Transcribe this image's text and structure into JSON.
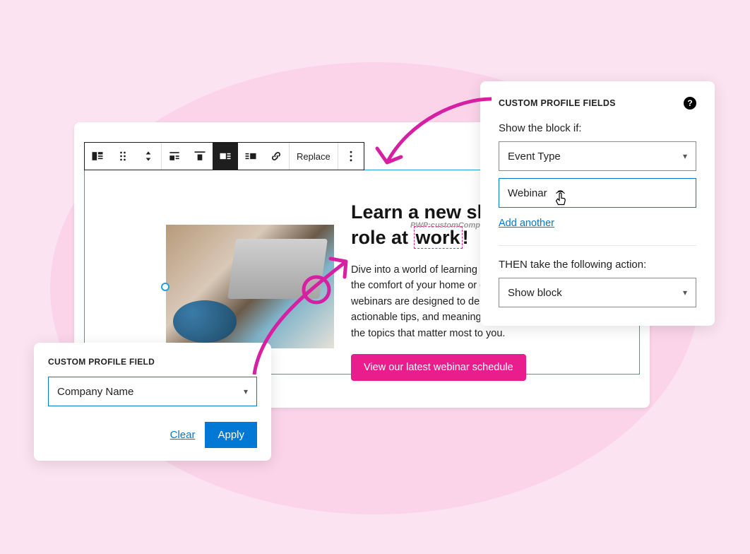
{
  "toolbar": {
    "replace_label": "Replace"
  },
  "block": {
    "heading_prefix": "Learn a new skill for your new role at ",
    "heading_highlight": "work",
    "heading_suffix": "!",
    "merge_tag": "PWP:customCompanyname",
    "body": "Dive into a world of learning and inspiration from the comfort of your home or office. EventSphere's webinars are designed to deliver expert insights, actionable tips, and meaningful discussions on the topics that matter most to you.",
    "cta_label": "View our latest webinar schedule"
  },
  "popup_left": {
    "title": "CUSTOM PROFILE FIELD",
    "selected": "Company Name",
    "clear_label": "Clear",
    "apply_label": "Apply"
  },
  "popup_right": {
    "title": "CUSTOM PROFILE FIELDS",
    "show_if_label": "Show the block if:",
    "condition_field": "Event Type",
    "condition_value": "Webinar",
    "add_another_label": "Add another",
    "then_label": "THEN take the following action:",
    "action_selected": "Show block"
  }
}
